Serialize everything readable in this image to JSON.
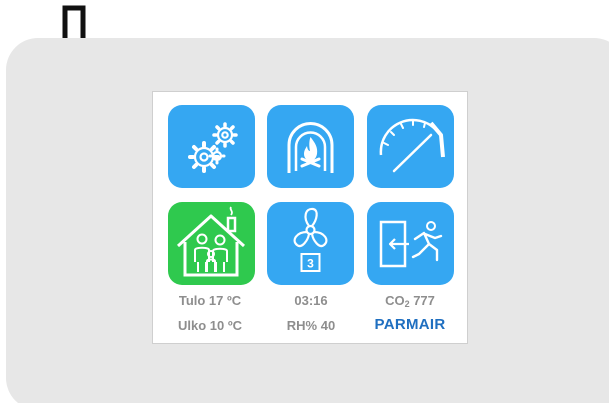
{
  "colors": {
    "tile_blue": "#35a7f2",
    "tile_green": "#2fc94e",
    "status_text": "#8e8e8e",
    "brand": "#1f6fc0",
    "panel_bg": "#e7e7e7"
  },
  "tiles": [
    {
      "icon": "gears-icon",
      "active": false
    },
    {
      "icon": "fireplace-icon",
      "active": false
    },
    {
      "icon": "gauge-icon",
      "active": false
    },
    {
      "icon": "home-family-icon",
      "active": true
    },
    {
      "icon": "fan-icon",
      "active": false,
      "speed": "3"
    },
    {
      "icon": "exit-running-icon",
      "active": false
    }
  ],
  "status": {
    "supply_temp": "Tulo  17 ºC",
    "outdoor_temp": "Ulko 10 ºC",
    "time": "03:16",
    "humidity": "RH% 40",
    "co2_label": "CO",
    "co2_sub": "2",
    "co2_value": " 777",
    "brand": "PARMAIR"
  }
}
